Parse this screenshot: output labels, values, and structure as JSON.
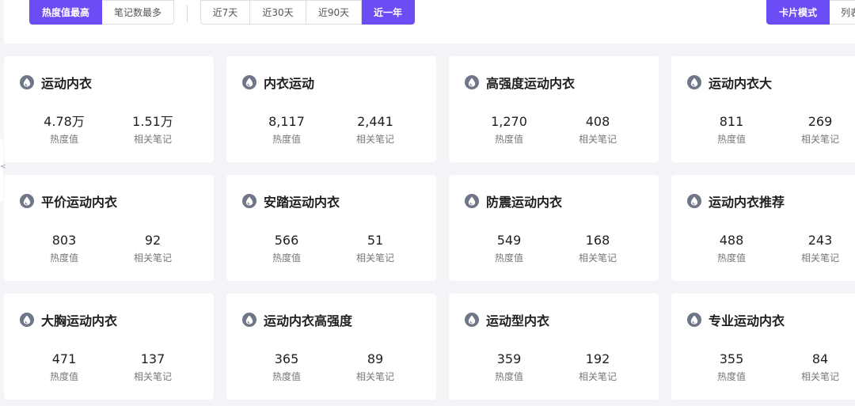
{
  "sort_buttons": [
    "热度值最高",
    "笔记数最多"
  ],
  "time_buttons": [
    "近7天",
    "近30天",
    "近90天",
    "近一年"
  ],
  "view_buttons": [
    "卡片模式",
    "列表"
  ],
  "stat_labels": {
    "heat": "热度值",
    "notes": "相关笔记"
  },
  "side_arrow": "<",
  "cards": [
    {
      "title": "运动内衣",
      "heat": "4.78万",
      "notes": "1.51万"
    },
    {
      "title": "内衣运动",
      "heat": "8,117",
      "notes": "2,441"
    },
    {
      "title": "高强度运动内衣",
      "heat": "1,270",
      "notes": "408"
    },
    {
      "title": "运动内衣大",
      "heat": "811",
      "notes": "269"
    },
    {
      "title": "平价运动内衣",
      "heat": "803",
      "notes": "92"
    },
    {
      "title": "安踏运动内衣",
      "heat": "566",
      "notes": "51"
    },
    {
      "title": "防震运动内衣",
      "heat": "549",
      "notes": "168"
    },
    {
      "title": "运动内衣推荐",
      "heat": "488",
      "notes": "243"
    },
    {
      "title": "大胸运动内衣",
      "heat": "471",
      "notes": "137"
    },
    {
      "title": "运动内衣高强度",
      "heat": "365",
      "notes": "89"
    },
    {
      "title": "运动型内衣",
      "heat": "359",
      "notes": "192"
    },
    {
      "title": "专业运动内衣",
      "heat": "355",
      "notes": "84"
    }
  ],
  "colors": {
    "accent": "#6c4cf5",
    "icon": "#6f7687",
    "background": "#f2f4f7"
  },
  "icon_name": "flame-icon"
}
